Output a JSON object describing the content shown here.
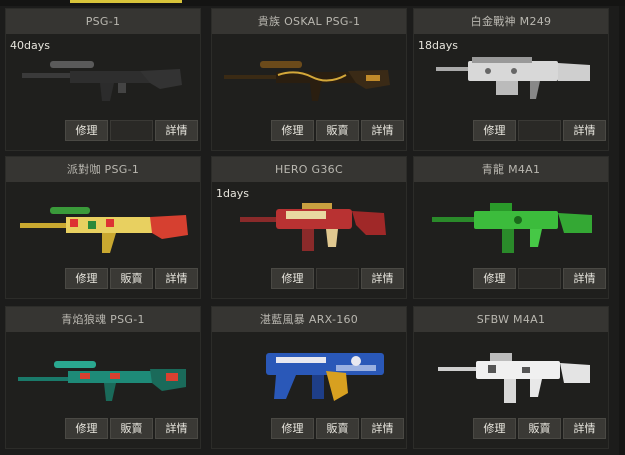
{
  "buttons": {
    "repair": "修理",
    "sell": "販賣",
    "details": "詳情"
  },
  "cards": [
    {
      "title": "PSG-1",
      "days": "40days",
      "icon": "sniper-rifle-black-icon",
      "sell": false
    },
    {
      "title": "貴族 OSKAL PSG-1",
      "days": "",
      "icon": "sniper-rifle-gold-icon",
      "sell": true
    },
    {
      "title": "白金戰神 M249",
      "days": "18days",
      "icon": "machine-gun-white-icon",
      "sell": false
    },
    {
      "title": "派對咖 PSG-1",
      "days": "",
      "icon": "sniper-rifle-party-icon",
      "sell": true
    },
    {
      "title": "HERO G36C",
      "days": "1days",
      "icon": "assault-rifle-hero-icon",
      "sell": false
    },
    {
      "title": "青龍 M4A1",
      "days": "",
      "icon": "assault-rifle-green-dragon-icon",
      "sell": false
    },
    {
      "title": "青焰狼魂 PSG-1",
      "days": "",
      "icon": "sniper-rifle-teal-wolf-icon",
      "sell": true
    },
    {
      "title": "湛藍風暴 ARX-160",
      "days": "",
      "icon": "assault-rifle-blue-storm-icon",
      "sell": true
    },
    {
      "title": "SFBW M4A1",
      "days": "",
      "icon": "assault-rifle-white-icon",
      "sell": true
    }
  ],
  "colors": {
    "accent": "#d8c43a",
    "title_bg": "#363532",
    "card_bg": "#1f1f1d"
  }
}
